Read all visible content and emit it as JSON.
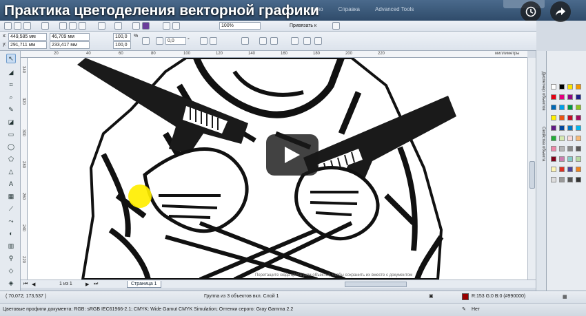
{
  "video": {
    "title": "Практика цветоделения векторной графики",
    "clock_icon": "clock-icon",
    "share_icon": "share-arrow-icon",
    "play_icon": "play-icon"
  },
  "menubar": {
    "items": [
      "Окно",
      "Справка",
      "Advanced Tools"
    ]
  },
  "toolbar": {
    "zoom_value": "100%",
    "snap_label": "Привязать к"
  },
  "property_bar": {
    "x_label": "x:",
    "x_value": "449,585 мм",
    "y_label": "y:",
    "y_value": "291,711 мм",
    "w_value": "46,709 мм",
    "h_value": "233,417 мм",
    "scale_x": "100,0",
    "scale_y": "100,0",
    "percent": "%",
    "rotation": "0,0",
    "rotation_unit": "°"
  },
  "ruler": {
    "h_ticks": [
      "20",
      "40",
      "60",
      "80",
      "100",
      "120",
      "140",
      "160",
      "180",
      "200",
      "220"
    ],
    "h_unit": "миллиметры",
    "v_ticks": [
      "340",
      "320",
      "300",
      "280",
      "260",
      "240",
      "220"
    ]
  },
  "canvas": {
    "hint_text": "Перетащите сюда цвета (или объекты), чтобы сохранить их вместе с документом"
  },
  "page_nav": {
    "page_count": "1 из 1",
    "page_tab": "Страница 1"
  },
  "docker": {
    "tabs": [
      "Диспетчер объектов",
      "Свойства объекта"
    ]
  },
  "status": {
    "coords": "( 70,072; 173,537 )",
    "selection": "Группа из 3 объектов вкл. Слой 1",
    "fill_value": "R:153 G:0 B:0 (#990000)",
    "outline_value": "Нет",
    "color_profiles": "Цветовые профили документа: RGB: sRGB IEC61966-2.1; CMYK: Wide Gamut CMYK Simulation; Оттенки серого: Gray Gamma 2.2",
    "fill_color": "#990000"
  },
  "palette_colors": [
    "#ffffff",
    "#000000",
    "#f9e400",
    "#f39800",
    "#e60012",
    "#e4007f",
    "#920783",
    "#1d2088",
    "#0068b7",
    "#00a0e9",
    "#009944",
    "#8fc31f",
    "#fff100",
    "#ea5514",
    "#c30d23",
    "#a40b5d",
    "#601986",
    "#00479d",
    "#0075c2",
    "#00b7ee",
    "#22ac38",
    "#d6e9b2",
    "#fadbda",
    "#f7b977",
    "#ee86a8",
    "#b5b5b6",
    "#898989",
    "#595757",
    "#7f0019",
    "#cc7eb1",
    "#84ccc9",
    "#b7d9a1",
    "#fef5b3",
    "#dc3023",
    "#4d4398",
    "#f0831e",
    "#dddddd",
    "#999999",
    "#555555",
    "#333333"
  ]
}
